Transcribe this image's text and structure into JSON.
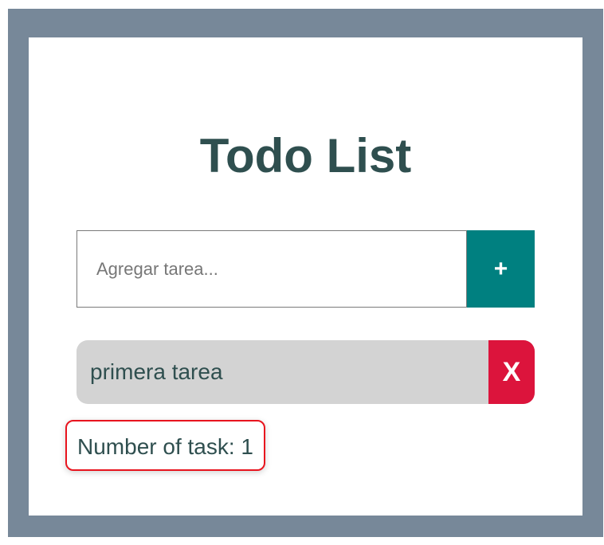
{
  "app": {
    "title": "Todo List"
  },
  "input": {
    "placeholder": "Agregar tarea...",
    "value": ""
  },
  "add_button": {
    "label": "+"
  },
  "tasks": [
    {
      "text": "primera tarea",
      "delete_label": "X"
    }
  ],
  "counter": {
    "text": "Number of task: 1"
  },
  "colors": {
    "frame": "#778899",
    "card": "#ffffff",
    "title": "#2f4f4f",
    "add_button": "#008080",
    "task_bg": "#d3d3d3",
    "delete_button": "#dc143c",
    "highlight_border": "#e8141e"
  }
}
